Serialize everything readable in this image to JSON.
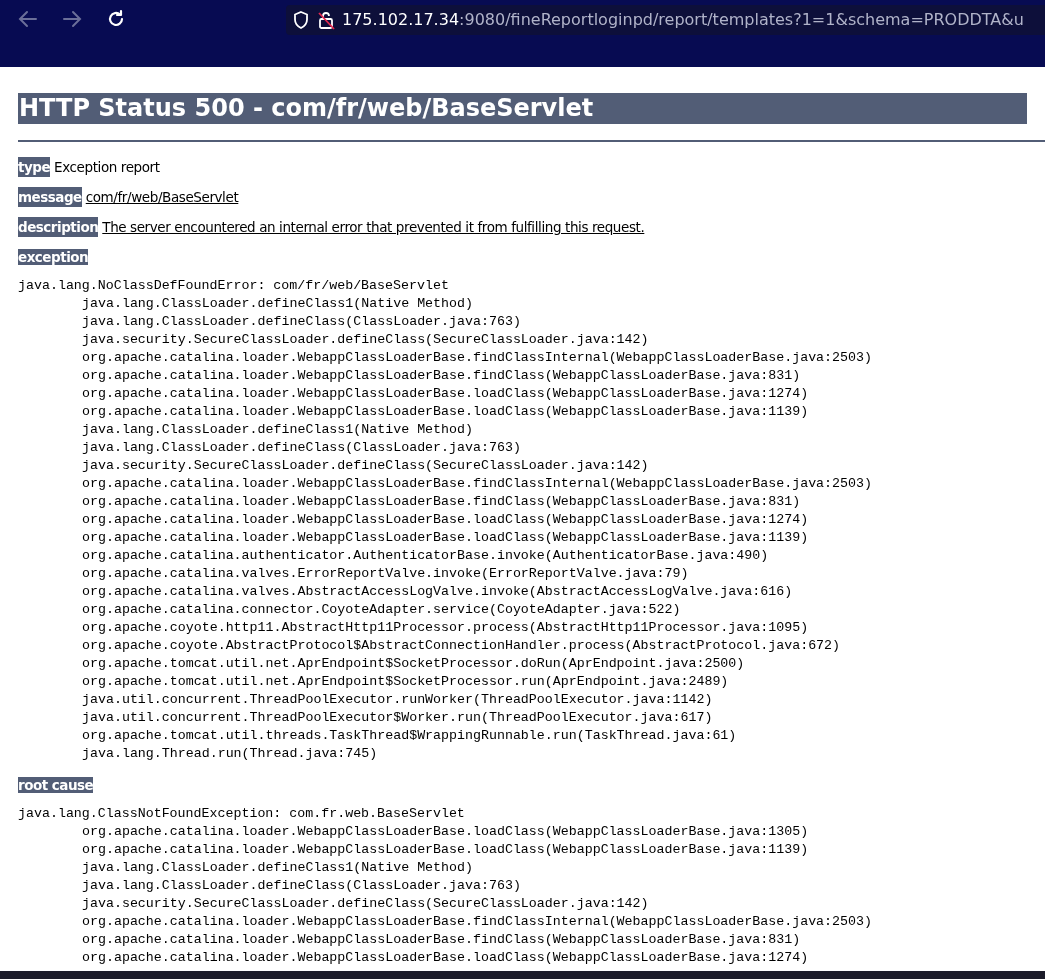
{
  "browser": {
    "url_host": "175.102.17.34",
    "url_rest": ":9080/fineReportloginpd/report/templates?1=1&schema=PRODDTA&u",
    "back_disabled": true,
    "forward_disabled": true
  },
  "title": "HTTP Status 500 - com/fr/web/BaseServlet",
  "fields": [
    {
      "label": "type",
      "value": "Exception report",
      "underlined": false
    },
    {
      "label": "message",
      "value": "com/fr/web/BaseServlet",
      "underlined": true
    },
    {
      "label": "description",
      "value": "The server encountered an internal error that prevented it from fulfilling this request.",
      "underlined": true
    }
  ],
  "sections": [
    {
      "label": "exception",
      "error": "java.lang.NoClassDefFoundError: com/fr/web/BaseServlet",
      "frames": [
        "java.lang.ClassLoader.defineClass1(Native Method)",
        "java.lang.ClassLoader.defineClass(ClassLoader.java:763)",
        "java.security.SecureClassLoader.defineClass(SecureClassLoader.java:142)",
        "org.apache.catalina.loader.WebappClassLoaderBase.findClassInternal(WebappClassLoaderBase.java:2503)",
        "org.apache.catalina.loader.WebappClassLoaderBase.findClass(WebappClassLoaderBase.java:831)",
        "org.apache.catalina.loader.WebappClassLoaderBase.loadClass(WebappClassLoaderBase.java:1274)",
        "org.apache.catalina.loader.WebappClassLoaderBase.loadClass(WebappClassLoaderBase.java:1139)",
        "java.lang.ClassLoader.defineClass1(Native Method)",
        "java.lang.ClassLoader.defineClass(ClassLoader.java:763)",
        "java.security.SecureClassLoader.defineClass(SecureClassLoader.java:142)",
        "org.apache.catalina.loader.WebappClassLoaderBase.findClassInternal(WebappClassLoaderBase.java:2503)",
        "org.apache.catalina.loader.WebappClassLoaderBase.findClass(WebappClassLoaderBase.java:831)",
        "org.apache.catalina.loader.WebappClassLoaderBase.loadClass(WebappClassLoaderBase.java:1274)",
        "org.apache.catalina.loader.WebappClassLoaderBase.loadClass(WebappClassLoaderBase.java:1139)",
        "org.apache.catalina.authenticator.AuthenticatorBase.invoke(AuthenticatorBase.java:490)",
        "org.apache.catalina.valves.ErrorReportValve.invoke(ErrorReportValve.java:79)",
        "org.apache.catalina.valves.AbstractAccessLogValve.invoke(AbstractAccessLogValve.java:616)",
        "org.apache.catalina.connector.CoyoteAdapter.service(CoyoteAdapter.java:522)",
        "org.apache.coyote.http11.AbstractHttp11Processor.process(AbstractHttp11Processor.java:1095)",
        "org.apache.coyote.AbstractProtocol$AbstractConnectionHandler.process(AbstractProtocol.java:672)",
        "org.apache.tomcat.util.net.AprEndpoint$SocketProcessor.doRun(AprEndpoint.java:2500)",
        "org.apache.tomcat.util.net.AprEndpoint$SocketProcessor.run(AprEndpoint.java:2489)",
        "java.util.concurrent.ThreadPoolExecutor.runWorker(ThreadPoolExecutor.java:1142)",
        "java.util.concurrent.ThreadPoolExecutor$Worker.run(ThreadPoolExecutor.java:617)",
        "org.apache.tomcat.util.threads.TaskThread$WrappingRunnable.run(TaskThread.java:61)",
        "java.lang.Thread.run(Thread.java:745)"
      ]
    },
    {
      "label": "root cause",
      "error": "java.lang.ClassNotFoundException: com.fr.web.BaseServlet",
      "frames": [
        "org.apache.catalina.loader.WebappClassLoaderBase.loadClass(WebappClassLoaderBase.java:1305)",
        "org.apache.catalina.loader.WebappClassLoaderBase.loadClass(WebappClassLoaderBase.java:1139)",
        "java.lang.ClassLoader.defineClass1(Native Method)",
        "java.lang.ClassLoader.defineClass(ClassLoader.java:763)",
        "java.security.SecureClassLoader.defineClass(SecureClassLoader.java:142)",
        "org.apache.catalina.loader.WebappClassLoaderBase.findClassInternal(WebappClassLoaderBase.java:2503)",
        "org.apache.catalina.loader.WebappClassLoaderBase.findClass(WebappClassLoaderBase.java:831)",
        "org.apache.catalina.loader.WebappClassLoaderBase.loadClass(WebappClassLoaderBase.java:1274)"
      ]
    }
  ]
}
